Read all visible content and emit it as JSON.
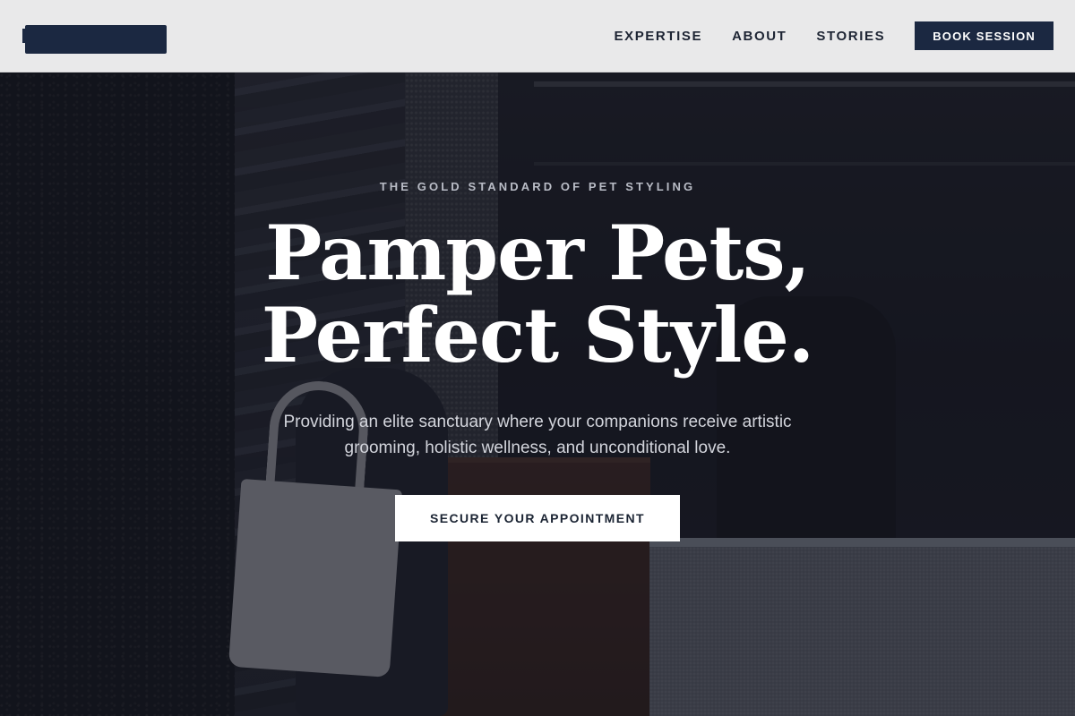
{
  "header": {
    "nav": [
      {
        "label": "EXPERTISE"
      },
      {
        "label": "ABOUT"
      },
      {
        "label": "STORIES"
      }
    ],
    "cta_label": "BOOK SESSION"
  },
  "hero": {
    "eyebrow": "THE GOLD STANDARD OF PET STYLING",
    "headline_line1": "Pamper Pets,",
    "headline_line2": "Perfect Style.",
    "subtitle": "Providing an elite sanctuary where your companions receive artistic grooming, holistic wellness, and unconditional love.",
    "cta_label": "SECURE YOUR APPOINTMENT"
  },
  "colors": {
    "header_bg": "#e9e9ea",
    "brand_navy": "#1b2841",
    "overlay": "#11131e",
    "text_light": "#ffffff"
  }
}
